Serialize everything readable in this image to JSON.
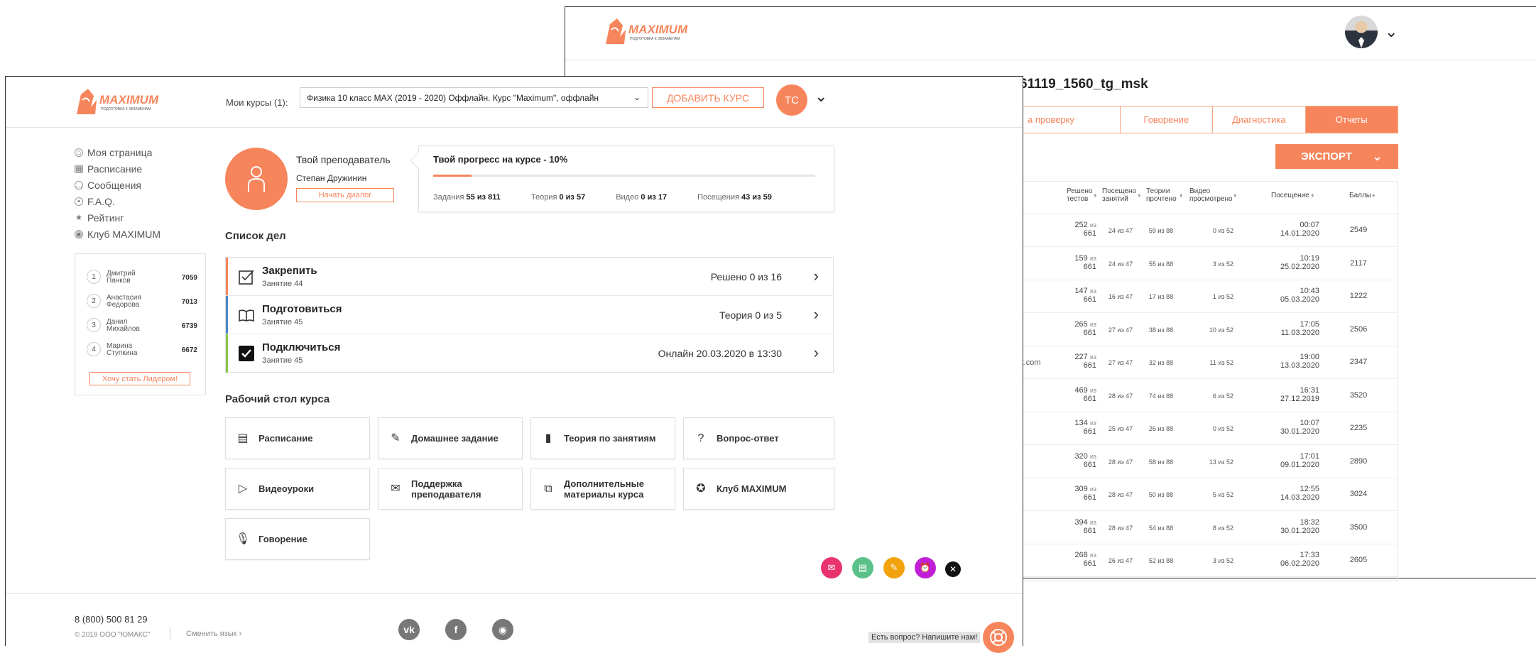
{
  "colors": {
    "accent": "#f7855c",
    "dark": "#222222"
  },
  "logo": {
    "brand": "MAXIMUM",
    "tagline": "ПОДГОТОВКА К ЭКЗАМЕНАМ"
  },
  "back_window": {
    "title_partial": "61119_1560_tg_msk",
    "tabs": [
      {
        "label": "а проверку",
        "active": false
      },
      {
        "label": "Говорение",
        "active": false
      },
      {
        "label": "Диагностика",
        "active": false
      },
      {
        "label": "Отчеты",
        "active": true
      }
    ],
    "export_label": "ЭКСПОРТ",
    "columns": [
      "Решено тестов",
      "Посещено занятий",
      "Теории прочтено",
      "Видео просмотрено",
      "Посещение",
      "Баллы"
    ],
    "email_fragment": "est.com",
    "rows": [
      {
        "solved": "252",
        "solved_of": "661",
        "visits": "24 из 47",
        "theory": "59 из 88",
        "video": "0 из 52",
        "time": "00:07",
        "date": "14.01.2020",
        "score": "2549"
      },
      {
        "solved": "159",
        "solved_of": "661",
        "visits": "24 из 47",
        "theory": "55 из 88",
        "video": "3 из 52",
        "time": "10:19",
        "date": "25.02.2020",
        "score": "2117"
      },
      {
        "solved": "147",
        "solved_of": "661",
        "visits": "16 из 47",
        "theory": "17 из 88",
        "video": "1 из 52",
        "time": "10:43",
        "date": "05.03.2020",
        "score": "1222"
      },
      {
        "solved": "265",
        "solved_of": "661",
        "visits": "27 из 47",
        "theory": "38 из 88",
        "video": "10 из 52",
        "time": "17:05",
        "date": "11.03.2020",
        "score": "2506"
      },
      {
        "solved": "227",
        "solved_of": "661",
        "visits": "27 из 47",
        "theory": "32 из 88",
        "video": "11 из 52",
        "time": "19:00",
        "date": "13.03.2020",
        "score": "2347"
      },
      {
        "solved": "469",
        "solved_of": "661",
        "visits": "28 из 47",
        "theory": "74 из 88",
        "video": "6 из 52",
        "time": "16:31",
        "date": "27.12.2019",
        "score": "3520"
      },
      {
        "solved": "134",
        "solved_of": "661",
        "visits": "25 из 47",
        "theory": "26 из 88",
        "video": "0 из 52",
        "time": "10:07",
        "date": "30.01.2020",
        "score": "2235"
      },
      {
        "solved": "320",
        "solved_of": "661",
        "visits": "28 из 47",
        "theory": "58 из 88",
        "video": "13 из 52",
        "time": "17:01",
        "date": "09.01.2020",
        "score": "2890"
      },
      {
        "solved": "309",
        "solved_of": "661",
        "visits": "28 из 47",
        "theory": "50 из 88",
        "video": "5 из 52",
        "time": "12:55",
        "date": "14.03.2020",
        "score": "3024"
      },
      {
        "solved": "394",
        "solved_of": "661",
        "visits": "28 из 47",
        "theory": "54 из 88",
        "video": "8 из 52",
        "time": "18:32",
        "date": "30.01.2020",
        "score": "3500"
      },
      {
        "solved": "268",
        "solved_of": "661",
        "visits": "26 из 47",
        "theory": "52 из 88",
        "video": "3 из 52",
        "time": "17:33",
        "date": "06.02.2020",
        "score": "2605"
      }
    ]
  },
  "front": {
    "my_courses_label": "Мои курсы (1):",
    "course_selected": "Физика 10 класс MAX (2019 - 2020) Оффлайн. Курс \"Maximum\", оффлайн",
    "add_course": "ДОБАВИТЬ КУРС",
    "user_initials": "ТС",
    "nav": [
      {
        "label": "Моя страница",
        "icon": "home-icon"
      },
      {
        "label": "Расписание",
        "icon": "calendar-icon"
      },
      {
        "label": "Сообщения",
        "icon": "chat-icon"
      },
      {
        "label": "F.A.Q.",
        "icon": "clock-icon"
      },
      {
        "label": "Рейтинг",
        "icon": "trophy-icon"
      },
      {
        "label": "Клуб MAXIMUM",
        "icon": "club-icon"
      }
    ],
    "leaders": [
      {
        "rank": "1",
        "first": "Дмитрий",
        "last": "Панков",
        "score": "7059"
      },
      {
        "rank": "2",
        "first": "Анастасия",
        "last": "Федорова",
        "score": "7013"
      },
      {
        "rank": "3",
        "first": "Данил",
        "last": "Михайлов",
        "score": "6739"
      },
      {
        "rank": "4",
        "first": "Марина",
        "last": "Ступкина",
        "score": "6672"
      }
    ],
    "be_leader": "Хочу стать Лидером!",
    "teacher": {
      "title": "Твой преподаватель",
      "name": "Степан Дружинин",
      "dialog": "Начать диалог"
    },
    "progress": {
      "title": "Твой прогресс на курсе - 10%",
      "percent": 10,
      "tasks_label": "Задания",
      "tasks_value": "55 из 811",
      "theory_label": "Теория",
      "theory_value": "0 из 57",
      "video_label": "Видео",
      "video_value": "0 из 17",
      "visits_label": "Посещения",
      "visits_value": "43 из 59"
    },
    "todo_title": "Список дел",
    "todo": [
      {
        "title": "Закрепить",
        "sub": "Занятие 44",
        "status": "Решено 0 из 16",
        "color": "#f7855c",
        "icon": "checklist-icon"
      },
      {
        "title": "Подготовиться",
        "sub": "Занятие 45",
        "status": "Теория 0 из 5",
        "color": "#4a86c5",
        "icon": "book-icon"
      },
      {
        "title": "Подключиться",
        "sub": "Занятие 45",
        "status": "Онлайн 20.03.2020 в 13:30",
        "color": "#8bc34a",
        "icon": "checkbox-icon"
      }
    ],
    "desk_title": "Рабочий стол курса",
    "tiles": [
      {
        "label": "Расписание",
        "icon": "calendar-icon"
      },
      {
        "label": "Домашнее задание",
        "icon": "pencil-icon"
      },
      {
        "label": "Теория по занятиям",
        "icon": "bookmark-icon"
      },
      {
        "label": "Вопрос-ответ",
        "icon": "faq-icon"
      },
      {
        "label": "Видеоуроки",
        "icon": "video-icon"
      },
      {
        "label": "Поддержка преподавателя",
        "icon": "support-icon"
      },
      {
        "label": "Дополнительные материалы курса",
        "icon": "materials-icon"
      },
      {
        "label": "Клуб MAXIMUM",
        "icon": "star-icon"
      },
      {
        "label": "Говорение",
        "icon": "microphone-icon"
      }
    ],
    "fab_colors": [
      "#e8336e",
      "#5cc08a",
      "#f2a20c",
      "#c01fd6"
    ],
    "footer": {
      "phone": "8 (800) 500 81 29",
      "copyright": "© 2019 ООО \"ЮМАКС\"",
      "language": "Сменить язык  ›",
      "ask": "Есть вопрос? Напишите нам!"
    }
  }
}
